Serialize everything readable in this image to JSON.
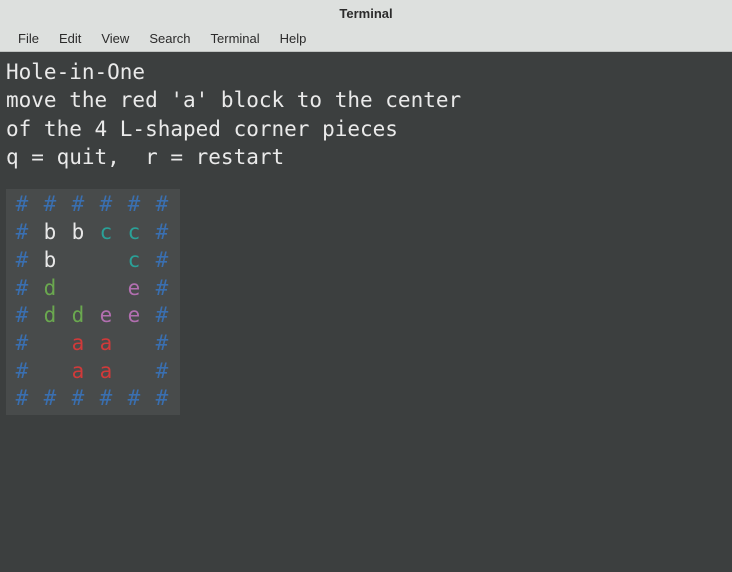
{
  "window": {
    "title": "Terminal"
  },
  "menu": {
    "items": [
      "File",
      "Edit",
      "View",
      "Search",
      "Terminal",
      "Help"
    ]
  },
  "game": {
    "title": "Hole-in-One",
    "instructions_line1": "move the red 'a' block to the center",
    "instructions_line2": "of the 4 L-shaped corner pieces",
    "controls": "q = quit,  r = restart",
    "board": [
      [
        "#",
        "#",
        "#",
        "#",
        "#",
        "#"
      ],
      [
        "#",
        "b",
        "b",
        "c",
        "c",
        "#"
      ],
      [
        "#",
        "b",
        " ",
        " ",
        "c",
        "#"
      ],
      [
        "#",
        "d",
        " ",
        " ",
        "e",
        "#"
      ],
      [
        "#",
        "d",
        "d",
        "e",
        "e",
        "#"
      ],
      [
        "#",
        " ",
        "a",
        "a",
        " ",
        "#"
      ],
      [
        "#",
        " ",
        "a",
        "a",
        " ",
        "#"
      ],
      [
        "#",
        "#",
        "#",
        "#",
        "#",
        "#"
      ]
    ],
    "colors": {
      "#": "#3a6fb0",
      "a": "#d03a3a",
      "b": "#e8e8e8",
      "c": "#2aa198",
      "d": "#6aa84f",
      "e": "#b26fb0"
    }
  }
}
